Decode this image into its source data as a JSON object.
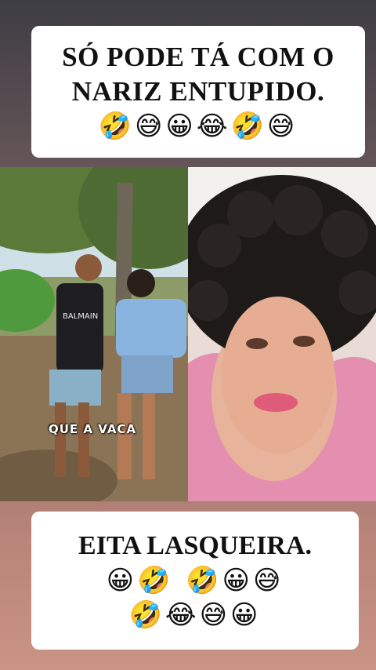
{
  "top_caption": {
    "line1": "SÓ PODE TÁ COM O",
    "line2": "NARIZ ENTUPIDO.",
    "emojis": "🤣😅😀😂🤣😅"
  },
  "video_left": {
    "subtitle": "QUE A VACA",
    "shirt_text": "BALMAIN"
  },
  "bottom_caption": {
    "line1": "EITA LASQUEIRA.",
    "emojis_row1": "😀🤣 🤣😀😅",
    "emojis_row2": "🤣😂😅😀"
  }
}
